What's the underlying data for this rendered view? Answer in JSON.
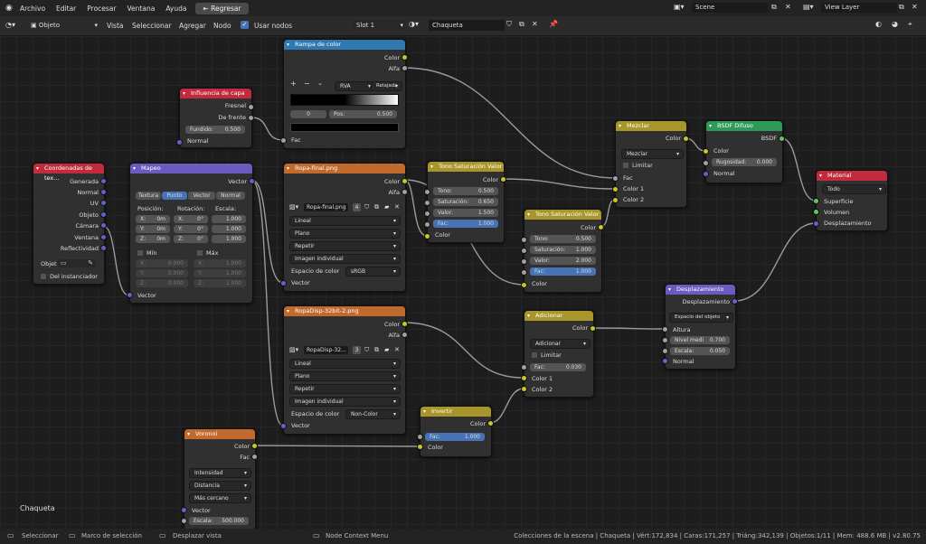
{
  "topbar": {
    "menus": [
      "Archivo",
      "Editar",
      "Procesar",
      "Ventana",
      "Ayuda"
    ],
    "back_button": "Regresar",
    "scene": "Scene",
    "view_layer": "View Layer"
  },
  "header2": {
    "mode": "Objeto",
    "menus": [
      "Vista",
      "Seleccionar",
      "Agregar",
      "Nodo"
    ],
    "use_nodes": "Usar nodos",
    "slot": "Slot 1",
    "material": "Chaqueta"
  },
  "nodes": {
    "rampa": {
      "title": "Rampa de color",
      "outs": [
        "Color",
        "Alfa"
      ],
      "mode": "RVA",
      "interp": "Relajada",
      "index": "0",
      "pos_label": "Pos:",
      "pos": "0.500",
      "in": "Fac"
    },
    "influencia": {
      "title": "Influencia de capa",
      "outs": [
        "Fresnel",
        "De frente"
      ],
      "fundido_label": "Fundido:",
      "fundido": "0.500",
      "in": "Normal"
    },
    "coords": {
      "title": "Coordenadas de tex...",
      "outs": [
        "Generada",
        "Normal",
        "UV",
        "Objeto",
        "Cámara",
        "Ventana",
        "Reflectividad"
      ],
      "obj_label": "Objet",
      "instanciador": "Del instanciador"
    },
    "mapeo": {
      "title": "Mapeo",
      "out": "Vector",
      "tabs": [
        "Textura",
        "Punto",
        "Vector",
        "Normal"
      ],
      "pos_label": "Posición:",
      "rot_label": "Rotación:",
      "esc_label": "Escala:",
      "rows": [
        {
          "axis": "X:",
          "pos": "0m",
          "rot": "0°",
          "esc": "1.000"
        },
        {
          "axis": "Y:",
          "pos": "0m",
          "rot": "0°",
          "esc": "1.000"
        },
        {
          "axis": "Z:",
          "pos": "0m",
          "rot": "0°",
          "esc": "1.000"
        }
      ],
      "min": "Mín",
      "max": "Máx",
      "minmax": [
        {
          "axis": "X:",
          "min": "0.000",
          "max": "1.000"
        },
        {
          "axis": "Y:",
          "min": "0.000",
          "max": "1.000"
        },
        {
          "axis": "Z:",
          "min": "0.000",
          "max": "1.000"
        }
      ],
      "in": "Vector"
    },
    "ropa": {
      "title": "Ropa-final.png",
      "outs": [
        "Color",
        "Alfa"
      ],
      "image": "Ropa-final.png",
      "users": "4",
      "opts": [
        "Lineal",
        "Plano",
        "Repetir",
        "Imagen individual"
      ],
      "cs_label": "Espacio de color",
      "cs": "sRGB",
      "in": "Vector"
    },
    "ropadisp": {
      "title": "RopaDisp-32bit-2.png",
      "outs": [
        "Color",
        "Alfa"
      ],
      "image": "RopaDisp-32...",
      "users": "3",
      "opts": [
        "Lineal",
        "Plano",
        "Repetir",
        "Imagen individual"
      ],
      "cs_label": "Espacio de color",
      "cs": "Non-Color",
      "in": "Vector"
    },
    "tono1": {
      "title": "Tono Saturación Valor",
      "out": "Color",
      "fields": [
        {
          "l": "Tono:",
          "v": "0.500"
        },
        {
          "l": "Saturación:",
          "v": "0.650"
        },
        {
          "l": "Valor:",
          "v": "1.500"
        },
        {
          "l": "Fac:",
          "v": "1.000"
        }
      ],
      "in": "Color"
    },
    "tono2": {
      "title": "Tono Saturación Valor",
      "out": "Color",
      "fields": [
        {
          "l": "Tono:",
          "v": "0.500"
        },
        {
          "l": "Saturación:",
          "v": "1.000"
        },
        {
          "l": "Valor:",
          "v": "2.000"
        },
        {
          "l": "Fac:",
          "v": "1.000"
        }
      ],
      "in": "Color"
    },
    "mezclar": {
      "title": "Mezclar",
      "out": "Color",
      "mode": "Mezclar",
      "limitar": "Limitar",
      "ins": [
        "Fac",
        "Color 1",
        "Color 2"
      ]
    },
    "bsdf": {
      "title": "BSDF Difuso",
      "out": "BSDF",
      "ins": [
        "Color"
      ],
      "rug_label": "Rugosidad:",
      "rug": "0.000",
      "normal": "Normal"
    },
    "material": {
      "title": "Material",
      "target": "Todo",
      "ins": [
        "Superficie",
        "Volumen",
        "Desplazamiento"
      ]
    },
    "desplaz": {
      "title": "Desplazamiento",
      "out": "Desplazamiento",
      "space": "Espacio del objeto",
      "altura": "Altura",
      "nivel_label": "Nivel medi",
      "nivel": "0.700",
      "escala_label": "Escala:",
      "escala": "0.050",
      "normal": "Normal"
    },
    "adicionar": {
      "title": "Adicionar",
      "out": "Color",
      "mode": "Adicionar",
      "limitar": "Limitar",
      "fac_label": "Fac:",
      "fac": "0.030",
      "ins": [
        "Color 1",
        "Color 2"
      ]
    },
    "invertir": {
      "title": "Invertir",
      "out": "Color",
      "fac_label": "Fac:",
      "fac": "1.000",
      "in": "Color"
    },
    "voronoi": {
      "title": "Voronoi",
      "outs": [
        "Color",
        "Fac"
      ],
      "opts": [
        "Intensidad",
        "Distancia",
        "Más cercano"
      ],
      "in": "Vector",
      "esc_label": "Escala:",
      "esc": "500.000"
    }
  },
  "material_label": "Chaqueta",
  "statusbar": {
    "items": [
      "Seleccionar",
      "Marco de selección",
      "Desplazar vista",
      "Node Context Menu"
    ],
    "stats": "Colecciones de la escena | Chaqueta | Vért:172,834 | Caras:171,257 | Triáng:342,139 | Objetos:1/11 | Mem: 488.6 MB | v2.80.75"
  },
  "colors": {
    "accent": "#4772b3",
    "header_texture": "#c06a2d",
    "header_shader": "#2e9a5a",
    "header_input": "#c22b3e",
    "header_vector": "#6b5bbf",
    "header_color": "#a8962a"
  }
}
